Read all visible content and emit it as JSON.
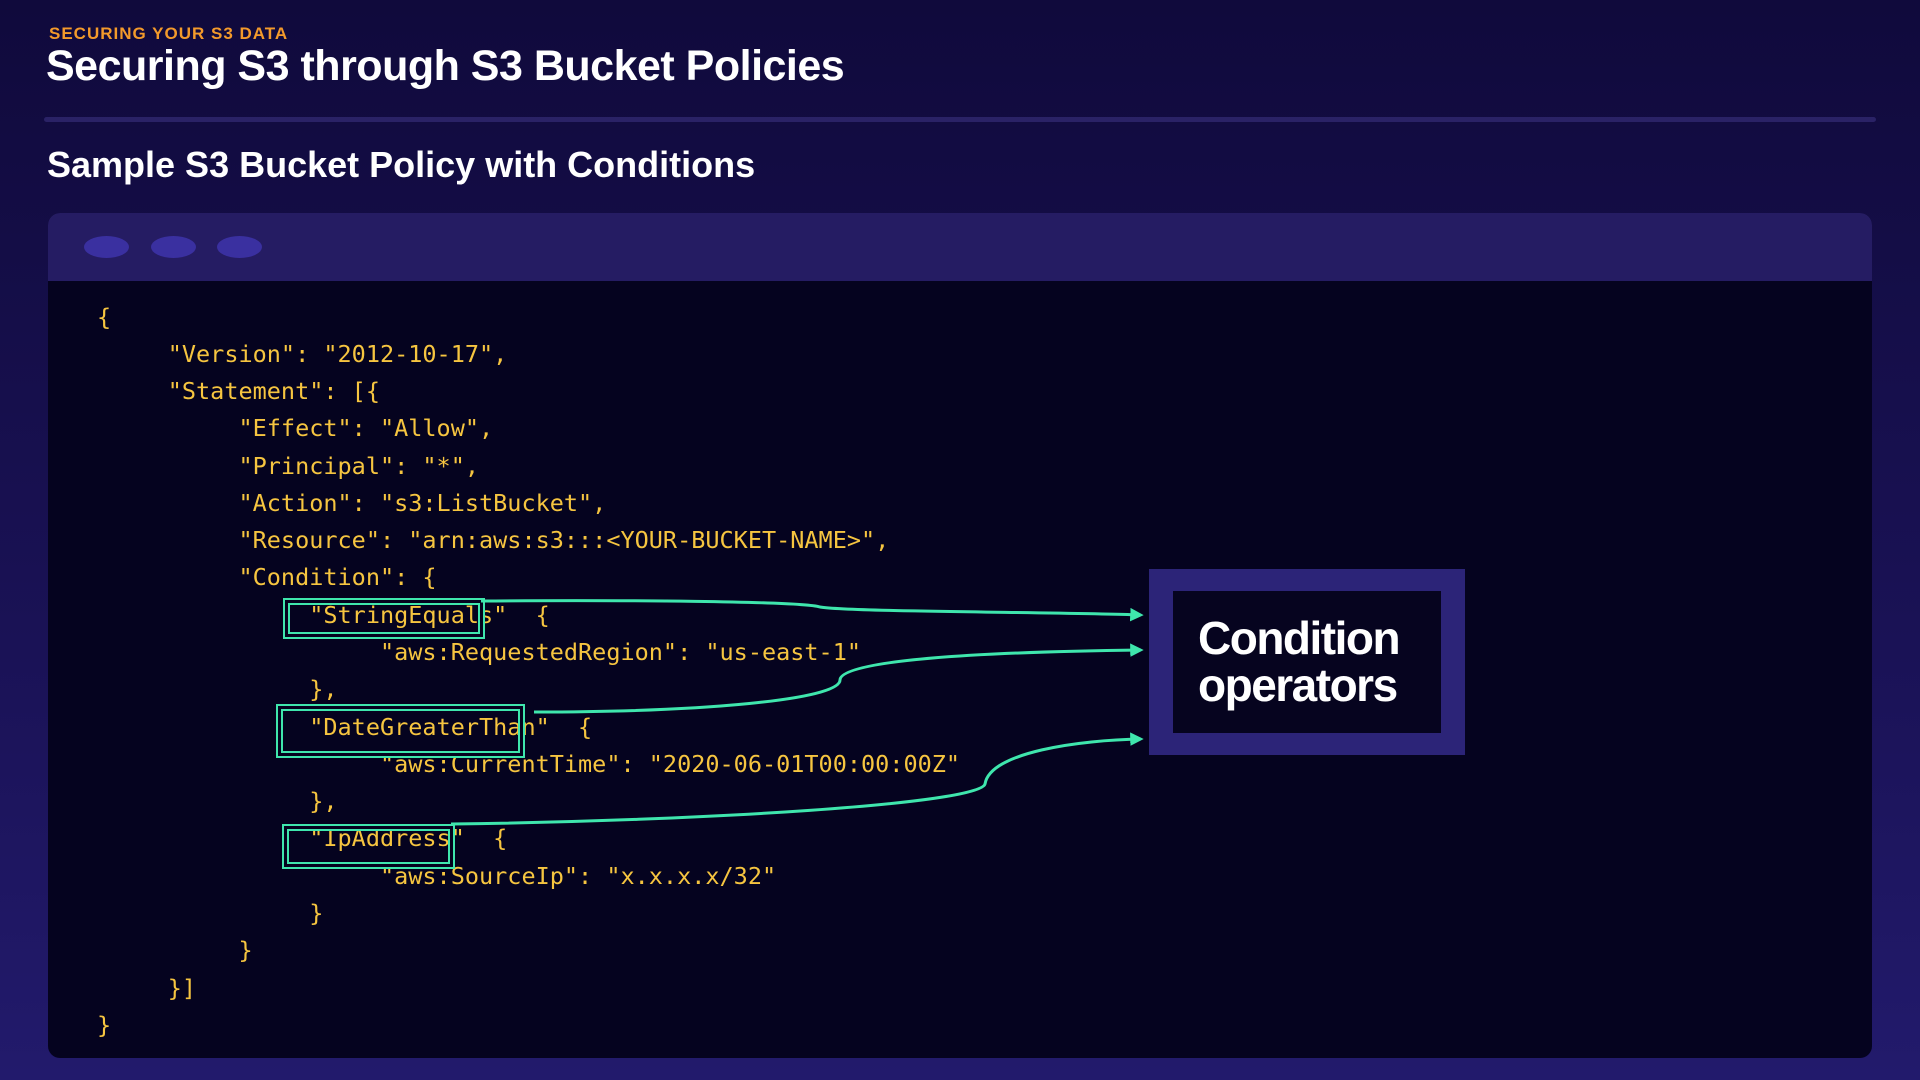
{
  "header": {
    "eyebrow": "SECURING YOUR S3 DATA",
    "title": "Securing S3 through S3 Bucket Policies",
    "subtitle": "Sample S3 Bucket Policy with Conditions"
  },
  "code_window": {
    "lines": [
      "{",
      "     \"Version\": \"2012-10-17\",",
      "     \"Statement\": [{",
      "          \"Effect\": \"Allow\",",
      "          \"Principal\": \"*\",",
      "          \"Action\": \"s3:ListBucket\",",
      "          \"Resource\": \"arn:aws:s3:::<YOUR-BUCKET-NAME>\",",
      "          \"Condition\": {",
      "               \"StringEquals\"  {",
      "                    \"aws:RequestedRegion\": \"us-east-1\"",
      "               },",
      "               \"DateGreaterThan\"  {",
      "                    \"aws:CurrentTime\": \"2020-06-01T00:00:00Z\"",
      "               },",
      "               \"IpAddress\"  {",
      "                    \"aws:SourceIp\": \"x.x.x.x/32\"",
      "               }",
      "          }",
      "     }]",
      "}"
    ]
  },
  "callout": {
    "line1": "Condition",
    "line2": "operators"
  },
  "colors": {
    "accent": "#f39a2b",
    "code_text": "#f6c540",
    "highlight": "#3fe6ad"
  }
}
